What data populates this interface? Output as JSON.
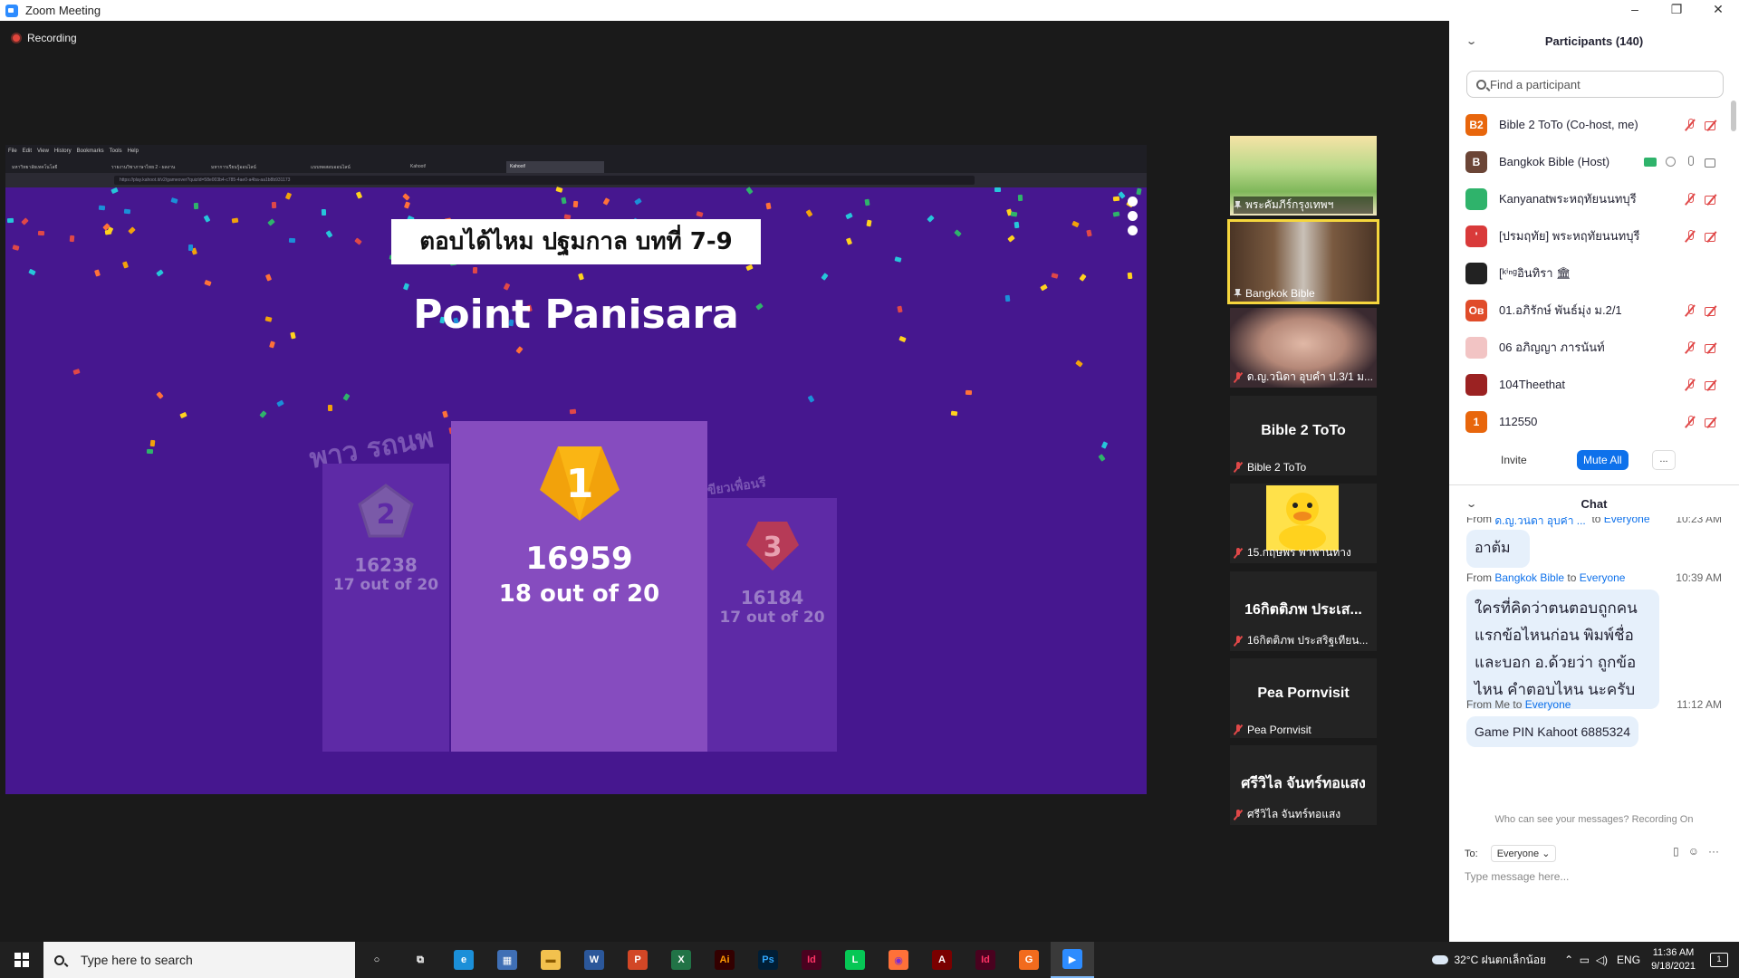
{
  "window": {
    "title": "Zoom Meeting",
    "controls": [
      "–",
      "❐",
      "✕"
    ]
  },
  "recording": {
    "label": "Recording"
  },
  "shared_screen": {
    "browser_menu": [
      "File",
      "Edit",
      "View",
      "History",
      "Bookmarks",
      "Tools",
      "Help"
    ],
    "tabs": [
      "มหาวิทยาลัยเทคโนโลยี",
      "รายงานวิชาภาษาไทย 2 - ผลงาน",
      "มหาการเรียนรู้ออนไลน์",
      "แบบทดสอบออนไลน์",
      "Kahoot!",
      "Kahoot!"
    ],
    "url": "https://play.kahoot.it/v2/gameover?quizId=58e003b4-c785-4ae0-a4ba-aa1b8b931173",
    "quiz_title": "ตอบได้ไหม ปฐมกาล บทที่ 7-9",
    "winner": "Point Panisara",
    "podium": [
      {
        "rank": "1",
        "score": "16959",
        "out_of": "18 out of 20",
        "name": "Point Panisara"
      },
      {
        "rank": "2",
        "score": "16238",
        "out_of": "17 out of 20",
        "name": "พาว รถนพ"
      },
      {
        "rank": "3",
        "score": "16184",
        "out_of": "17 out of 20",
        "name": "เขียวเพื่อนรี"
      }
    ]
  },
  "gallery": [
    {
      "label": "พระคัมภีร์กรุงเทพฯ",
      "center": "",
      "muted": false,
      "pinned": true
    },
    {
      "label": "Bangkok Bible",
      "center": "",
      "muted": false,
      "pinned": true,
      "active": true
    },
    {
      "label": "ด.ญ.วนิดา อุบคำ ป.3/1 ม...",
      "center": "",
      "muted": true
    },
    {
      "label": "Bible 2 ToTo",
      "center": "Bible 2 ToTo",
      "muted": true
    },
    {
      "label": "15.กฤษพร พาพานทาง",
      "center": "",
      "muted": true
    },
    {
      "label": "16กิตติภพ ประสริฐเทียน...",
      "center": "16กิตติภพ ประเส...",
      "muted": true
    },
    {
      "label": "Pea Pornvisit",
      "center": "Pea Pornvisit",
      "muted": true
    },
    {
      "label": "ศรีวิไล จันทร์ทอแสง",
      "center": "ศรีวิไล จันทร์ทอแสง",
      "muted": true
    }
  ],
  "participants": {
    "header": "Participants (140)",
    "search_placeholder": "Find a participant",
    "list": [
      {
        "avatar": "B2",
        "color": "#e8660c",
        "name": "Bible 2 ToTo (Co-host, me)",
        "mic": "off",
        "cam": "off"
      },
      {
        "avatar": "B",
        "color": "#6b4536",
        "name": "Bangkok Bible (Host)",
        "mic": "on",
        "cam": "on",
        "sharing": true
      },
      {
        "avatar": "",
        "color": "#2fb36b",
        "name": "Kanyanatพระหฤทัยนนทบุรี",
        "mic": "off",
        "cam": "off"
      },
      {
        "avatar": "'",
        "color": "#d93a3a",
        "name": "[ปรมฤทัย] พระหฤทัยนนทบุรี",
        "mic": "off",
        "cam": "off"
      },
      {
        "avatar": "",
        "color": "#222222",
        "name": "[ᵏⁱⁿᵍอินทิรา 🏛",
        "mic": "none",
        "cam": "none"
      },
      {
        "avatar": "Ов",
        "color": "#e04c2a",
        "name": "01.อภิรักษ์ พันธ์มุ่ง ม.2/1",
        "mic": "off",
        "cam": "off"
      },
      {
        "avatar": "",
        "color": "#f2c4c4",
        "name": "06 อภิญญา ภารนันท์",
        "mic": "off",
        "cam": "off"
      },
      {
        "avatar": "",
        "color": "#9b2222",
        "name": "104Theethat",
        "mic": "off",
        "cam": "off"
      },
      {
        "avatar": "1",
        "color": "#e8660c",
        "name": "112550",
        "mic": "off",
        "cam": "off"
      }
    ],
    "actions": {
      "invite": "Invite",
      "mute_all": "Mute All",
      "more": "..."
    }
  },
  "chat": {
    "header": "Chat",
    "messages": [
      {
        "from": "ด.ญ.วนิดา อุบคำ ...",
        "to": "Everyone",
        "time": "10:23 AM",
        "text": "อาต้ม"
      },
      {
        "from": "Bangkok Bible",
        "to": "Everyone",
        "time": "10:39 AM",
        "text": "ใครที่คิดว่าตนตอบถูกคนแรกข้อไหนก่อน พิมพ์ชื่อ และบอก อ.ด้วยว่า ถูกข้อไหน คำตอบไหน นะครับ"
      },
      {
        "from": "Me",
        "to": "Everyone",
        "time": "11:12 AM",
        "text": "Game PIN Kahoot 6885324"
      }
    ],
    "from_word": "From",
    "to_word": "to",
    "who_can_see": "Who can see your messages? Recording On",
    "to_label": "To:",
    "to_value": "Everyone",
    "input_placeholder": "Type message here..."
  },
  "taskbar": {
    "search_placeholder": "Type here to search",
    "weather": "32°C  ฝนตกเล็กน้อย",
    "language": "ENG",
    "time": "11:36 AM",
    "date": "9/18/2021",
    "notification_count": "1",
    "apps": [
      {
        "name": "cortana-icon",
        "glyph": "○",
        "bg": "transparent",
        "fg": "#fff"
      },
      {
        "name": "task-view-icon",
        "glyph": "⧉",
        "bg": "transparent",
        "fg": "#fff"
      },
      {
        "name": "edge-icon",
        "glyph": "e",
        "bg": "#1b8fd8",
        "fg": "#fff"
      },
      {
        "name": "calculator-icon",
        "glyph": "▦",
        "bg": "#3f6fb5",
        "fg": "#fff"
      },
      {
        "name": "file-explorer-icon",
        "glyph": "▬",
        "bg": "#f2c14e",
        "fg": "#8a5a00"
      },
      {
        "name": "word-icon",
        "glyph": "W",
        "bg": "#2b579a",
        "fg": "#fff"
      },
      {
        "name": "powerpoint-icon",
        "glyph": "P",
        "bg": "#d24726",
        "fg": "#fff"
      },
      {
        "name": "excel-icon",
        "glyph": "X",
        "bg": "#217346",
        "fg": "#fff"
      },
      {
        "name": "illustrator-icon",
        "glyph": "Ai",
        "bg": "#330000",
        "fg": "#ff9a00"
      },
      {
        "name": "photoshop-icon",
        "glyph": "Ps",
        "bg": "#001e36",
        "fg": "#31a8ff"
      },
      {
        "name": "indesign-icon",
        "glyph": "Id",
        "bg": "#49021f",
        "fg": "#ff3366"
      },
      {
        "name": "line-icon",
        "glyph": "L",
        "bg": "#06c755",
        "fg": "#fff"
      },
      {
        "name": "firefox-icon",
        "glyph": "◉",
        "bg": "#ff7139",
        "fg": "#7a2bd6"
      },
      {
        "name": "acrobat-icon",
        "glyph": "A",
        "bg": "#7a0000",
        "fg": "#fff"
      },
      {
        "name": "indesign-icon-2",
        "glyph": "Id",
        "bg": "#49021f",
        "fg": "#ff3366"
      },
      {
        "name": "g-app-icon",
        "glyph": "G",
        "bg": "#f26b1d",
        "fg": "#fff"
      },
      {
        "name": "zoom-icon",
        "glyph": "▶",
        "bg": "#2d8cff",
        "fg": "#fff",
        "active": true
      }
    ]
  }
}
